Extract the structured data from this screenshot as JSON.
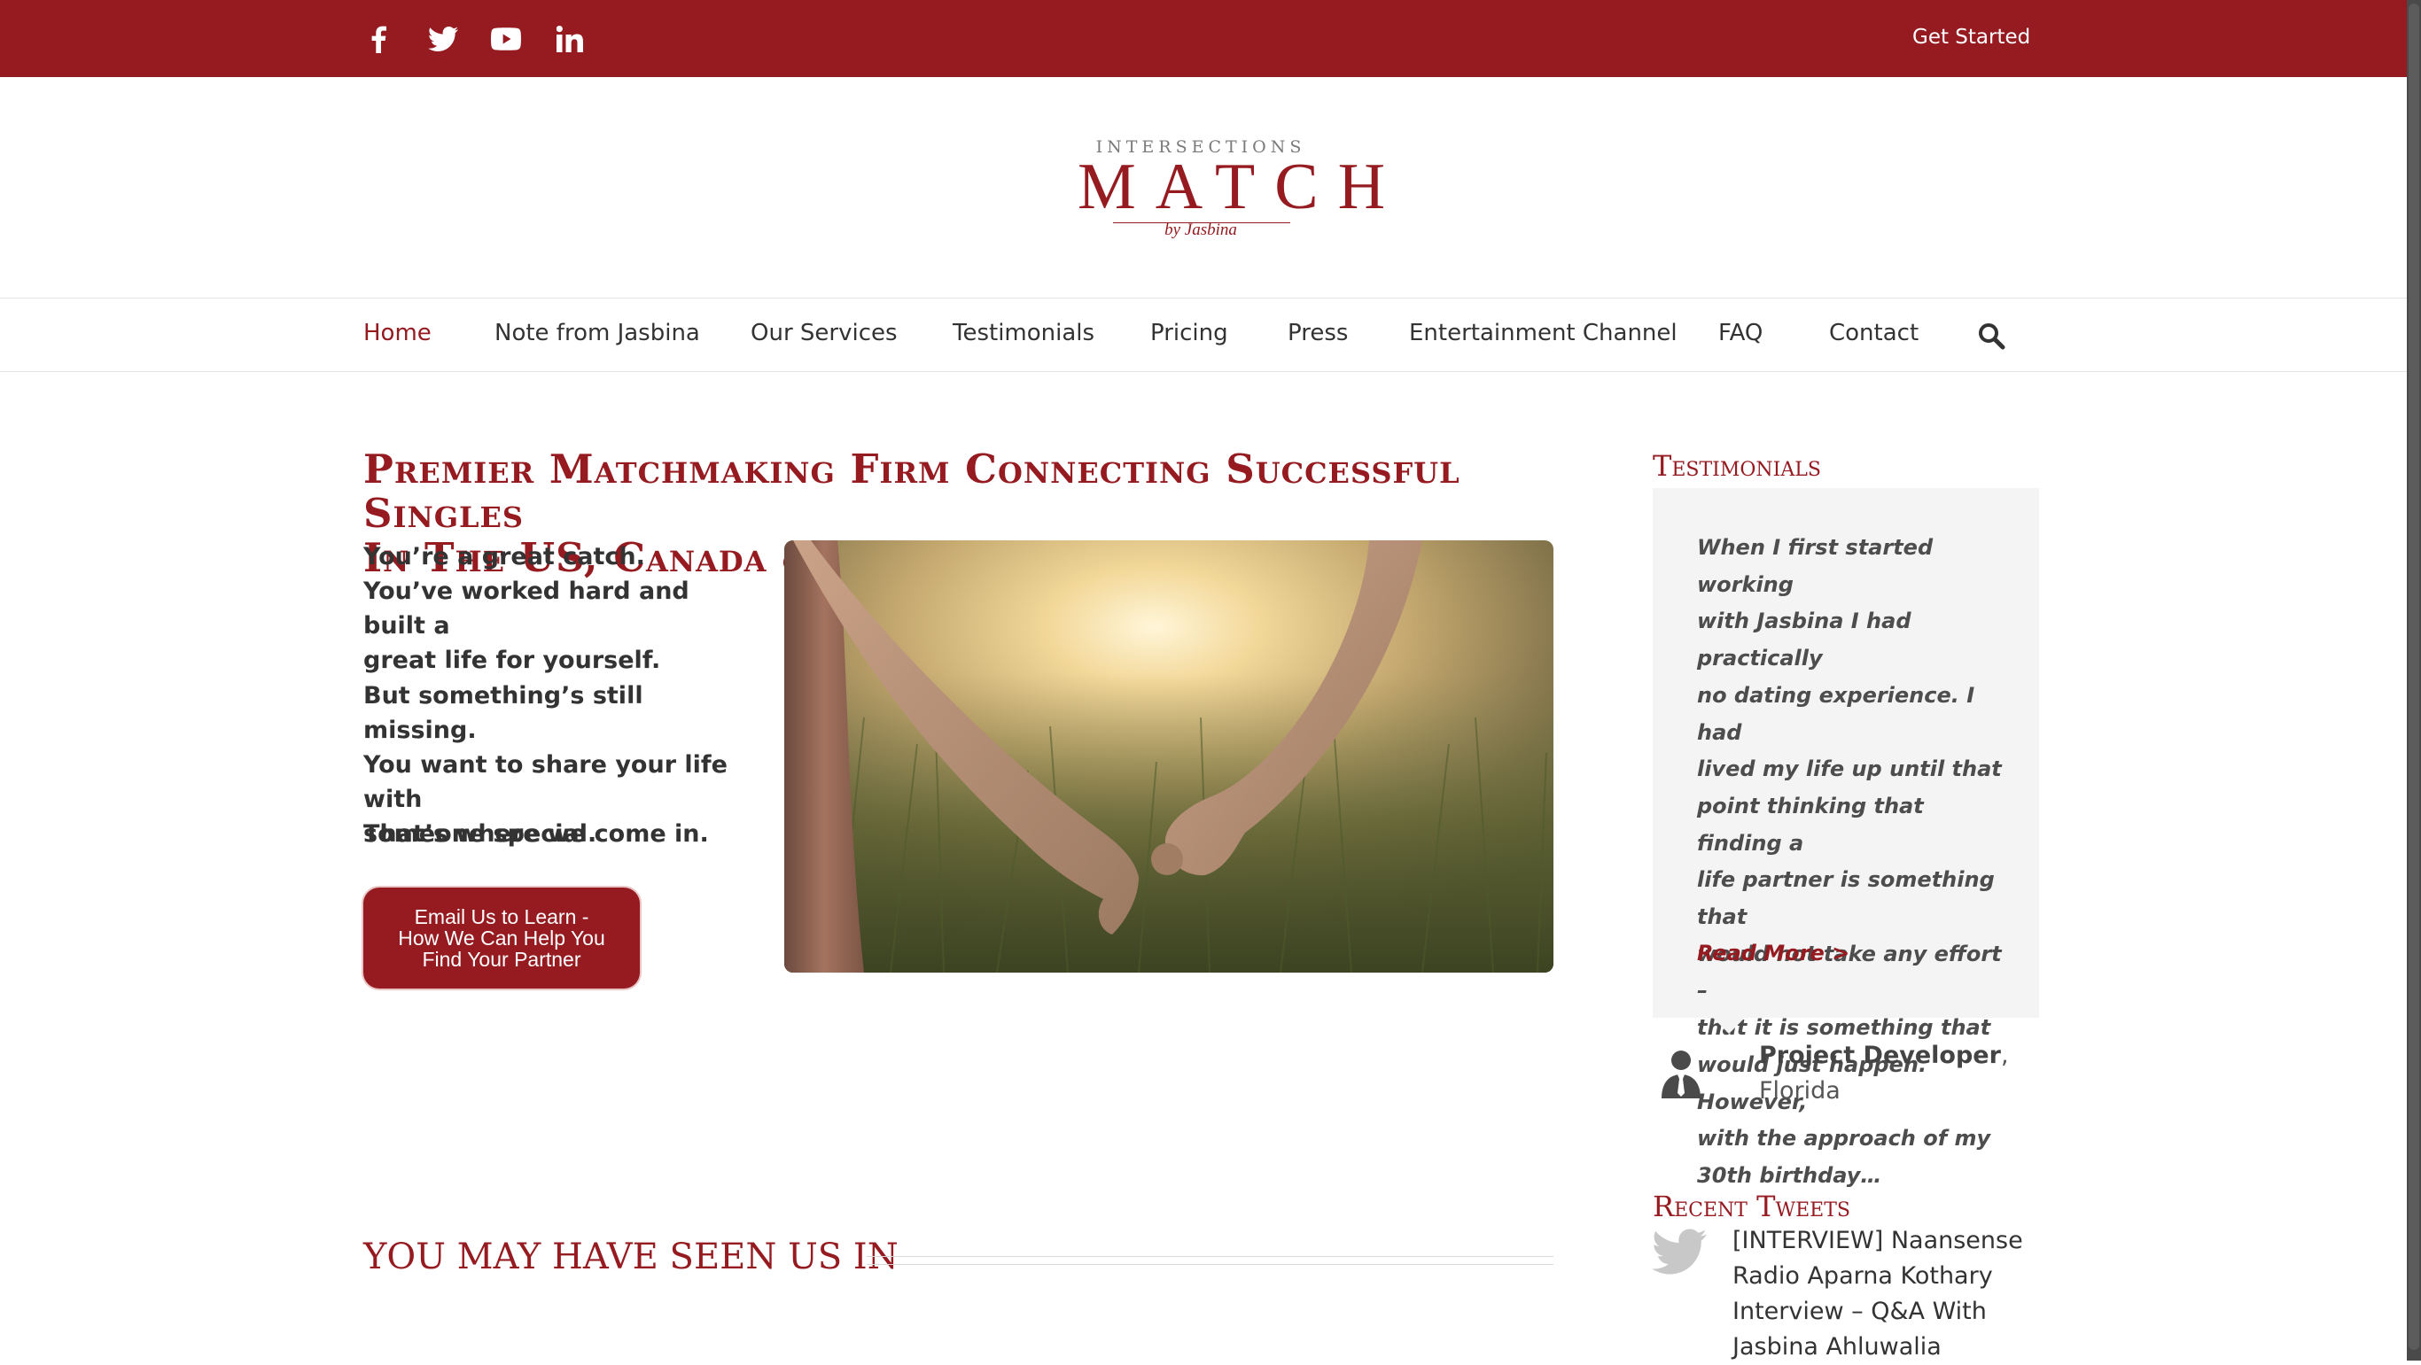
{
  "topbar": {
    "social": [
      {
        "icon": "facebook-icon",
        "label": "Facebook"
      },
      {
        "icon": "twitter-icon",
        "label": "Twitter"
      },
      {
        "icon": "youtube-icon",
        "label": "YouTube"
      },
      {
        "icon": "linkedin-icon",
        "label": "LinkedIn"
      }
    ],
    "cta_label": "Get Started"
  },
  "logo": {
    "top": "INTERSECTIONS",
    "main": "MATCH",
    "by": "by Jasbina"
  },
  "nav": {
    "items": [
      {
        "label": "Home",
        "active": true
      },
      {
        "label": "Note from Jasbina"
      },
      {
        "label": "Our Services"
      },
      {
        "label": "Testimonials"
      },
      {
        "label": "Pricing"
      },
      {
        "label": "Press"
      },
      {
        "label": "Entertainment Channel"
      },
      {
        "label": "FAQ"
      },
      {
        "label": "Contact"
      }
    ],
    "search_icon": "search-icon"
  },
  "main": {
    "headline_line1": "Premier Matchmaking Firm Connecting Successful Singles",
    "headline_line2": "In The US, Canada & The UK",
    "intro": {
      "p1": [
        "You’re a great catch.",
        "You’ve worked hard and built a",
        "great life for yourself."
      ],
      "p2": [
        "But something’s still missing.",
        "You want to share your life with",
        "someone special."
      ],
      "p3": "That’s where we come in."
    },
    "cta": [
      "Email Us to Learn -",
      "How We Can Help You",
      "Find Your Partner"
    ],
    "seen_in_title": "YOU MAY HAVE SEEN US IN"
  },
  "sidebar": {
    "testimonials_title": "Testimonials",
    "quote_lines": [
      "When I first started working",
      "with Jasbina I had practically",
      "no dating experience. I had",
      "lived my life up until that",
      "point thinking that finding a",
      "life partner is something that",
      "would not take any effort –",
      "that it is something that",
      "would just happen. However,",
      "with the approach of my",
      "30th birthday…"
    ],
    "read_more": "Read More >",
    "author_name": "Project Developer",
    "author_location": "Florida",
    "recent_tweets_title": "Recent Tweets",
    "tweet_lines": [
      "[INTERVIEW] Naansense",
      "Radio Aparna Kothary",
      "Interview – Q&A With",
      "Jasbina Ahluwalia"
    ]
  },
  "colors": {
    "brand": "#951b20",
    "text": "#333333",
    "testimonial_bg": "#f4f4f4"
  }
}
